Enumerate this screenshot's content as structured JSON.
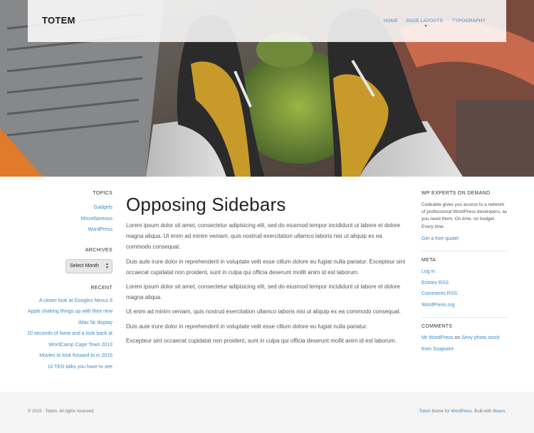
{
  "header": {
    "logo": "TOTEM",
    "nav": [
      {
        "label": "HOME"
      },
      {
        "label": "PAGE LAYOUTS"
      },
      {
        "label": "TYPOGRAPHY"
      }
    ]
  },
  "left_sidebar": {
    "topics_title": "TOPICS",
    "topics": [
      "Gadgets",
      "Miscellaneous",
      "WordPress"
    ],
    "archives_title": "ARCHIVES",
    "archives_select": "Select Month",
    "recent_title": "RECENT",
    "recent": [
      "A closer look at Googles Nexus 6",
      "Apple shaking things up with their new",
      "iMac 5k display",
      "10 seconds of fame and a look back at",
      "WordCamp Cape Town 2013",
      "Movies to look forward to in 2015",
      "10 TED talks you have to see"
    ]
  },
  "main": {
    "title": "Opposing Sidebars",
    "paragraphs": [
      "Lorem ipsum dolor sit amet, consectetur adipisicing elit, sed do eiusmod tempor incididunt ut labore et dolore magna aliqua. Ut enim ad minim veniam, quis nostrud exercitation ullamco laboris nisi ut aliquip ex ea commodo consequat.",
      "Duis aute irure dolor in reprehenderit in voluptate velit esse cillum dolore eu fugiat nulla pariatur. Excepteur sint occaecat cupidatat non proident, sunt in culpa qui officia deserunt mollit anim id est laborum.",
      "Lorem ipsum dolor sit amet, consectetur adipisicing elit, sed do eiusmod tempor incididunt ut labore et dolore magna aliqua.",
      "Ut enim ad minim veniam, quis nostrud exercitation ullamco laboris nisi ut aliquip ex ea commodo consequat.",
      "Duis aute irure dolor in reprehenderit in voluptate velit esse cillum dolore eu fugiat nulla pariatur.",
      "Excepteur sint occaecat cupidatat non proident, sunt in culpa qui officia deserunt mollit anim id est laborum."
    ]
  },
  "right_sidebar": {
    "wp_title": "WP EXPERTS ON DEMAND",
    "wp_text": "Codeable gives you access to a network of professional WordPress developers, as you need them. On time, on budget. Every time.",
    "wp_link": "Get a free quote!",
    "meta_title": "META",
    "meta_links": [
      "Log in",
      "Entries RSS",
      "Comments RSS",
      "WordPress.org"
    ],
    "comments_title": "COMMENTS",
    "comment_author": "Mr WordPress",
    "comment_on": "on",
    "comment_post": "Sexy photo stock from Snapwire"
  },
  "footer": {
    "copyright": "© 2015 - Totem. All rights reserved.",
    "credit_theme": "Totem",
    "credit_mid": "theme for",
    "credit_wp": "WordPress",
    "credit_built": ". Built-with",
    "credit_beans": "Beans",
    "credit_end": "."
  },
  "colors": {
    "accent": "#3b8bc7",
    "footer_bg": "#f5f5f5"
  }
}
